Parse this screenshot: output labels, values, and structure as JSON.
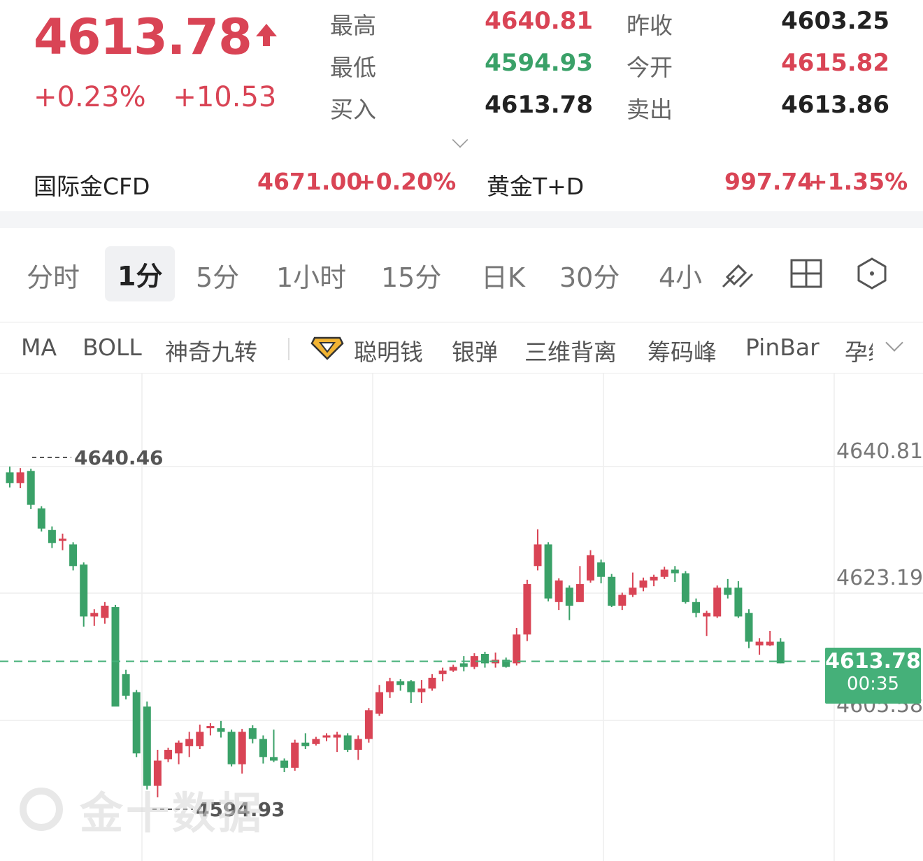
{
  "quote": {
    "price": "4613.78",
    "change_pct": "+0.23%",
    "change_abs": "+10.53"
  },
  "stats": [
    {
      "label": "最高",
      "value": "4640.81",
      "color": "red"
    },
    {
      "label": "昨收",
      "value": "4603.25",
      "color": "dark"
    },
    {
      "label": "最低",
      "value": "4594.93",
      "color": "green"
    },
    {
      "label": "今开",
      "value": "4615.82",
      "color": "red"
    },
    {
      "label": "买入",
      "value": "4613.78",
      "color": "dark"
    },
    {
      "label": "卖出",
      "value": "4613.86",
      "color": "dark"
    }
  ],
  "related": [
    {
      "name": "国际金CFD",
      "price": "4671.00",
      "pct": "+0.20%"
    },
    {
      "name": "黄金T+D",
      "price": "997.74",
      "pct": "+1.35%"
    }
  ],
  "tabs": [
    "分时",
    "1分",
    "5分",
    "1小时",
    "15分",
    "日K",
    "30分",
    "4小"
  ],
  "active_tab": "1分",
  "tool_icons": [
    "draw-line-icon",
    "layout-grid-icon",
    "settings-hexagon-icon"
  ],
  "indicators": [
    "MA",
    "BOLL",
    "神奇九转",
    "聪明钱",
    "银弹",
    "三维背离",
    "筹码峰",
    "PinBar",
    "孕线"
  ],
  "colors": {
    "up": "#d94455",
    "down": "#3aa168",
    "tag": "#45b079"
  },
  "chart_data": {
    "type": "candlestick",
    "y_axis_labels": [
      "4640.81",
      "4623.19",
      "4605.58"
    ],
    "ylim": [
      4594.0,
      4646.0
    ],
    "current_price": {
      "value": "4613.78",
      "countdown": "00:35"
    },
    "annotations": [
      {
        "label": "4640.46",
        "kind": "high"
      },
      {
        "label": "4594.93",
        "kind": "low"
      }
    ],
    "candles": [
      [
        4640.0,
        4638.5,
        4640.8,
        4637.9
      ],
      [
        4638.5,
        4640.0,
        4640.6,
        4637.8
      ],
      [
        4640.2,
        4635.5,
        4640.5,
        4634.9
      ],
      [
        4635.0,
        4632.2,
        4635.3,
        4631.8
      ],
      [
        4632.0,
        4630.2,
        4632.5,
        4629.5
      ],
      [
        4630.5,
        4630.8,
        4631.5,
        4629.2
      ],
      [
        4630.0,
        4627.0,
        4630.3,
        4626.4
      ],
      [
        4627.2,
        4620.0,
        4627.5,
        4618.6
      ],
      [
        4620.0,
        4620.5,
        4621.0,
        4618.7
      ],
      [
        4619.8,
        4621.5,
        4622.0,
        4619.0
      ],
      [
        4621.3,
        4607.5,
        4621.6,
        4608.0
      ],
      [
        4612.0,
        4609.0,
        4612.6,
        4608.5
      ],
      [
        4609.5,
        4601.0,
        4609.8,
        4600.5
      ],
      [
        4607.5,
        4596.5,
        4608.2,
        4596.0
      ],
      [
        4596.5,
        4600.0,
        4601.5,
        4594.9
      ],
      [
        4600.2,
        4601.5,
        4601.8,
        4599.8
      ],
      [
        4601.0,
        4602.5,
        4602.8,
        4599.5
      ],
      [
        4602.0,
        4603.0,
        4604.0,
        4600.5
      ],
      [
        4602.0,
        4604.0,
        4605.0,
        4601.6
      ],
      [
        4604.5,
        4604.8,
        4605.2,
        4603.5
      ],
      [
        4604.5,
        4604.0,
        4605.5,
        4603.2
      ],
      [
        4604.0,
        4599.5,
        4604.3,
        4599.2
      ],
      [
        4599.5,
        4604.0,
        4604.4,
        4598.2
      ],
      [
        4604.5,
        4603.0,
        4604.9,
        4602.4
      ],
      [
        4603.0,
        4600.5,
        4603.5,
        4599.6
      ],
      [
        4600.5,
        4600.0,
        4604.3,
        4599.8
      ],
      [
        4600.0,
        4599.0,
        4600.3,
        4598.4
      ],
      [
        4599.0,
        4602.5,
        4602.9,
        4598.6
      ],
      [
        4602.5,
        4602.0,
        4603.8,
        4601.6
      ],
      [
        4602.3,
        4603.0,
        4603.3,
        4602.1
      ],
      [
        4603.2,
        4603.5,
        4603.8,
        4602.7
      ],
      [
        4603.2,
        4603.6,
        4604.0,
        4601.2
      ],
      [
        4603.5,
        4601.5,
        4603.8,
        4601.2
      ],
      [
        4601.5,
        4603.0,
        4603.5,
        4600.1
      ],
      [
        4603.0,
        4607.0,
        4607.3,
        4602.5
      ],
      [
        4606.5,
        4609.5,
        4610.5,
        4606.2
      ],
      [
        4609.5,
        4611.0,
        4611.5,
        4608.7
      ],
      [
        4611.0,
        4610.5,
        4611.3,
        4609.7
      ],
      [
        4611.0,
        4609.5,
        4611.2,
        4608.0
      ],
      [
        4609.5,
        4610.0,
        4611.2,
        4608.0
      ],
      [
        4610.0,
        4611.5,
        4612.0,
        4609.7
      ],
      [
        4612.0,
        4612.5,
        4612.9,
        4611.0
      ],
      [
        4612.5,
        4613.0,
        4613.3,
        4612.3
      ],
      [
        4613.5,
        4613.0,
        4614.5,
        4612.4
      ],
      [
        4613.0,
        4614.5,
        4614.9,
        4612.7
      ],
      [
        4614.8,
        4613.5,
        4615.1,
        4612.9
      ],
      [
        4613.5,
        4614.0,
        4615.0,
        4612.9
      ],
      [
        4614.0,
        4613.0,
        4614.3,
        4612.9
      ],
      [
        4613.5,
        4617.5,
        4618.4,
        4613.2
      ],
      [
        4617.5,
        4624.5,
        4625.1,
        4616.6
      ],
      [
        4627.0,
        4630.0,
        4632.1,
        4626.4
      ],
      [
        4630.0,
        4622.5,
        4630.3,
        4622.1
      ],
      [
        4622.0,
        4625.0,
        4625.3,
        4620.9
      ],
      [
        4624.0,
        4621.5,
        4624.3,
        4619.5
      ],
      [
        4622.0,
        4624.5,
        4627.0,
        4622.0
      ],
      [
        4625.0,
        4628.5,
        4629.2,
        4624.7
      ],
      [
        4627.5,
        4625.5,
        4627.9,
        4624.6
      ],
      [
        4625.5,
        4621.5,
        4625.9,
        4621.3
      ],
      [
        4621.5,
        4623.0,
        4623.3,
        4620.9
      ],
      [
        4623.0,
        4624.0,
        4626.1,
        4622.7
      ],
      [
        4624.0,
        4625.0,
        4625.4,
        4623.5
      ],
      [
        4625.0,
        4625.5,
        4625.8,
        4624.2
      ],
      [
        4625.5,
        4626.5,
        4626.9,
        4625.2
      ],
      [
        4626.5,
        4626.0,
        4627.0,
        4624.8
      ],
      [
        4626.0,
        4622.0,
        4626.3,
        4621.8
      ],
      [
        4622.0,
        4620.5,
        4622.5,
        4619.9
      ],
      [
        4620.0,
        4620.5,
        4620.8,
        4617.3
      ],
      [
        4620.0,
        4624.0,
        4624.3,
        4619.8
      ],
      [
        4624.0,
        4623.0,
        4625.2,
        4622.5
      ],
      [
        4624.0,
        4620.0,
        4624.9,
        4619.8
      ],
      [
        4620.5,
        4616.5,
        4621.0,
        4615.6
      ],
      [
        4616.0,
        4616.5,
        4617.0,
        4614.7
      ],
      [
        4616.0,
        4616.5,
        4618.0,
        4615.9
      ],
      [
        4616.5,
        4613.5,
        4617.0,
        4613.5
      ]
    ]
  }
}
